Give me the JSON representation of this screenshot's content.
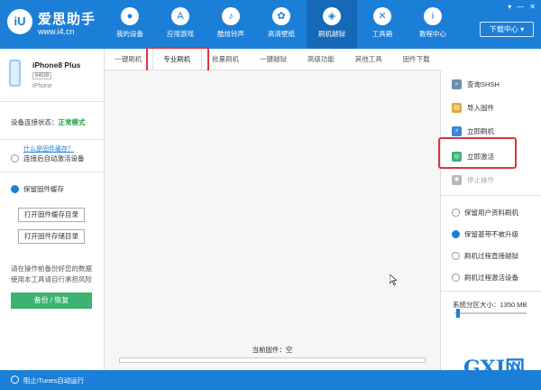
{
  "app": {
    "name": "爱思助手",
    "site": "www.i4.cn"
  },
  "nav": [
    {
      "label": "我的设备",
      "icon": ""
    },
    {
      "label": "应用游戏",
      "icon": "A"
    },
    {
      "label": "酷炫铃声",
      "icon": "♪"
    },
    {
      "label": "高清壁纸",
      "icon": "✿"
    },
    {
      "label": "刷机越狱",
      "icon": "◈"
    },
    {
      "label": "工具箱",
      "icon": "✕"
    },
    {
      "label": "教程中心",
      "icon": "i"
    }
  ],
  "window": {
    "download_label": "下载中心"
  },
  "device": {
    "name": "iPhone8 Plus",
    "capacity": "64GB",
    "type": "iPhone"
  },
  "left": {
    "status_label": "设备连接状态：",
    "status_value": "正常模式",
    "auto_activate": "连接后自动激活设备",
    "keep_cache": "保留固件缓存",
    "cache_link": "什么是固件缓存？",
    "open_cache_btn": "打开固件缓存目录",
    "open_store_btn": "打开固件存储目录",
    "note": "请在操作前备份好您的数据使用本工具请自行承担风险",
    "backup_btn": "备份 / 恢复"
  },
  "tabs": [
    {
      "label": "一键刷机"
    },
    {
      "label": "专业刷机"
    },
    {
      "label": "批量刷机"
    },
    {
      "label": "一键越狱"
    },
    {
      "label": "高级功能"
    },
    {
      "label": "其他工具"
    },
    {
      "label": "固件下载"
    }
  ],
  "main": {
    "firmware_label": "当前固件：空"
  },
  "right": {
    "actions": [
      {
        "label": "查询SHSH",
        "icon": "⌕",
        "color": "#6b8fb0"
      },
      {
        "label": "导入固件",
        "icon": "▤",
        "color": "#e2a93b"
      },
      {
        "label": "立即刷机",
        "icon": "⚡",
        "color": "#3a86d8"
      },
      {
        "label": "立即激活",
        "icon": "◎",
        "color": "#3cb371"
      },
      {
        "label": "停止操作",
        "icon": "✱",
        "color": "#b8b8b8"
      }
    ],
    "options": [
      {
        "label": "保留用户资料刷机",
        "checked": false
      },
      {
        "label": "保留基带不被升级",
        "checked": true
      },
      {
        "label": "刷机过程直接越狱",
        "checked": false
      },
      {
        "label": "刷机过程激活设备",
        "checked": false
      }
    ],
    "sys_partition": "系统分区大小：1350 MB",
    "slider_fraction": 0.03
  },
  "footer": {
    "itunes": "阻止iTunes自动运行"
  },
  "watermark": {
    "main": "GXI网",
    "sub": "system.com"
  }
}
